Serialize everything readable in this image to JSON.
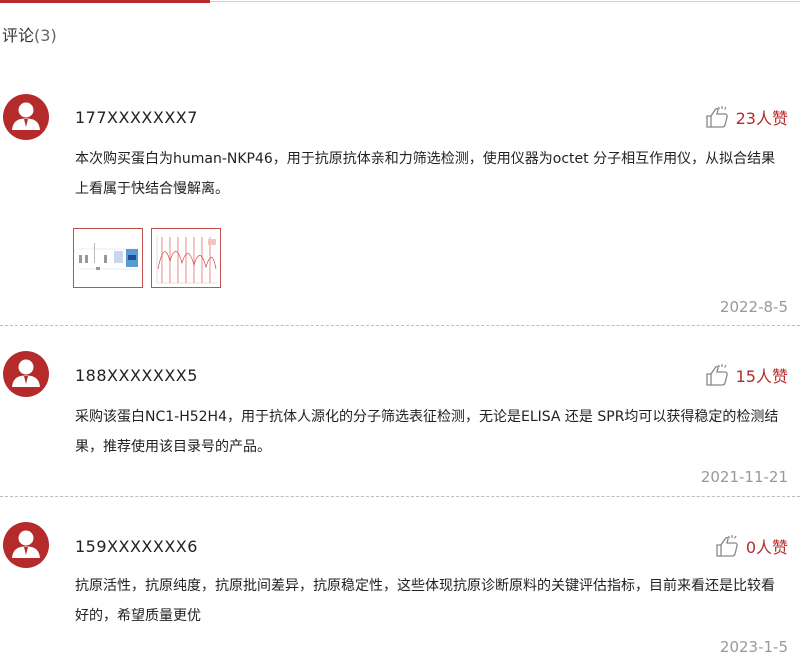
{
  "header": {
    "title": "评论",
    "count": "(3)"
  },
  "colors": {
    "accent": "#b72a2a",
    "avatar_bg": "#b52b2b",
    "date": "#999999"
  },
  "comments": [
    {
      "user": "177XXXXXXX7",
      "likes": "23人赞",
      "text": "本次购买蛋白为human-NKP46，用于抗原抗体亲和力筛选检测，使用仪器为octet 分子相互作用仪，从拟合结果上看属于快结合慢解离。",
      "date": "2022-8-5",
      "images": [
        "result-table-thumbnail",
        "binding-curve-thumbnail"
      ]
    },
    {
      "user": "188XXXXXXX5",
      "likes": "15人赞",
      "text": "采购该蛋白NC1-H52H4，用于抗体人源化的分子筛选表征检测，无论是ELISA 还是 SPR均可以获得稳定的检测结果，推荐使用该目录号的产品。",
      "date": "2021-11-21"
    },
    {
      "user": "159XXXXXXX6",
      "likes": "0人赞",
      "text": "抗原活性，抗原纯度，抗原批间差异，抗原稳定性，这些体现抗原诊断原料的关键评估指标，目前来看还是比较看好的，希望质量更优",
      "date": "2023-1-5"
    }
  ]
}
